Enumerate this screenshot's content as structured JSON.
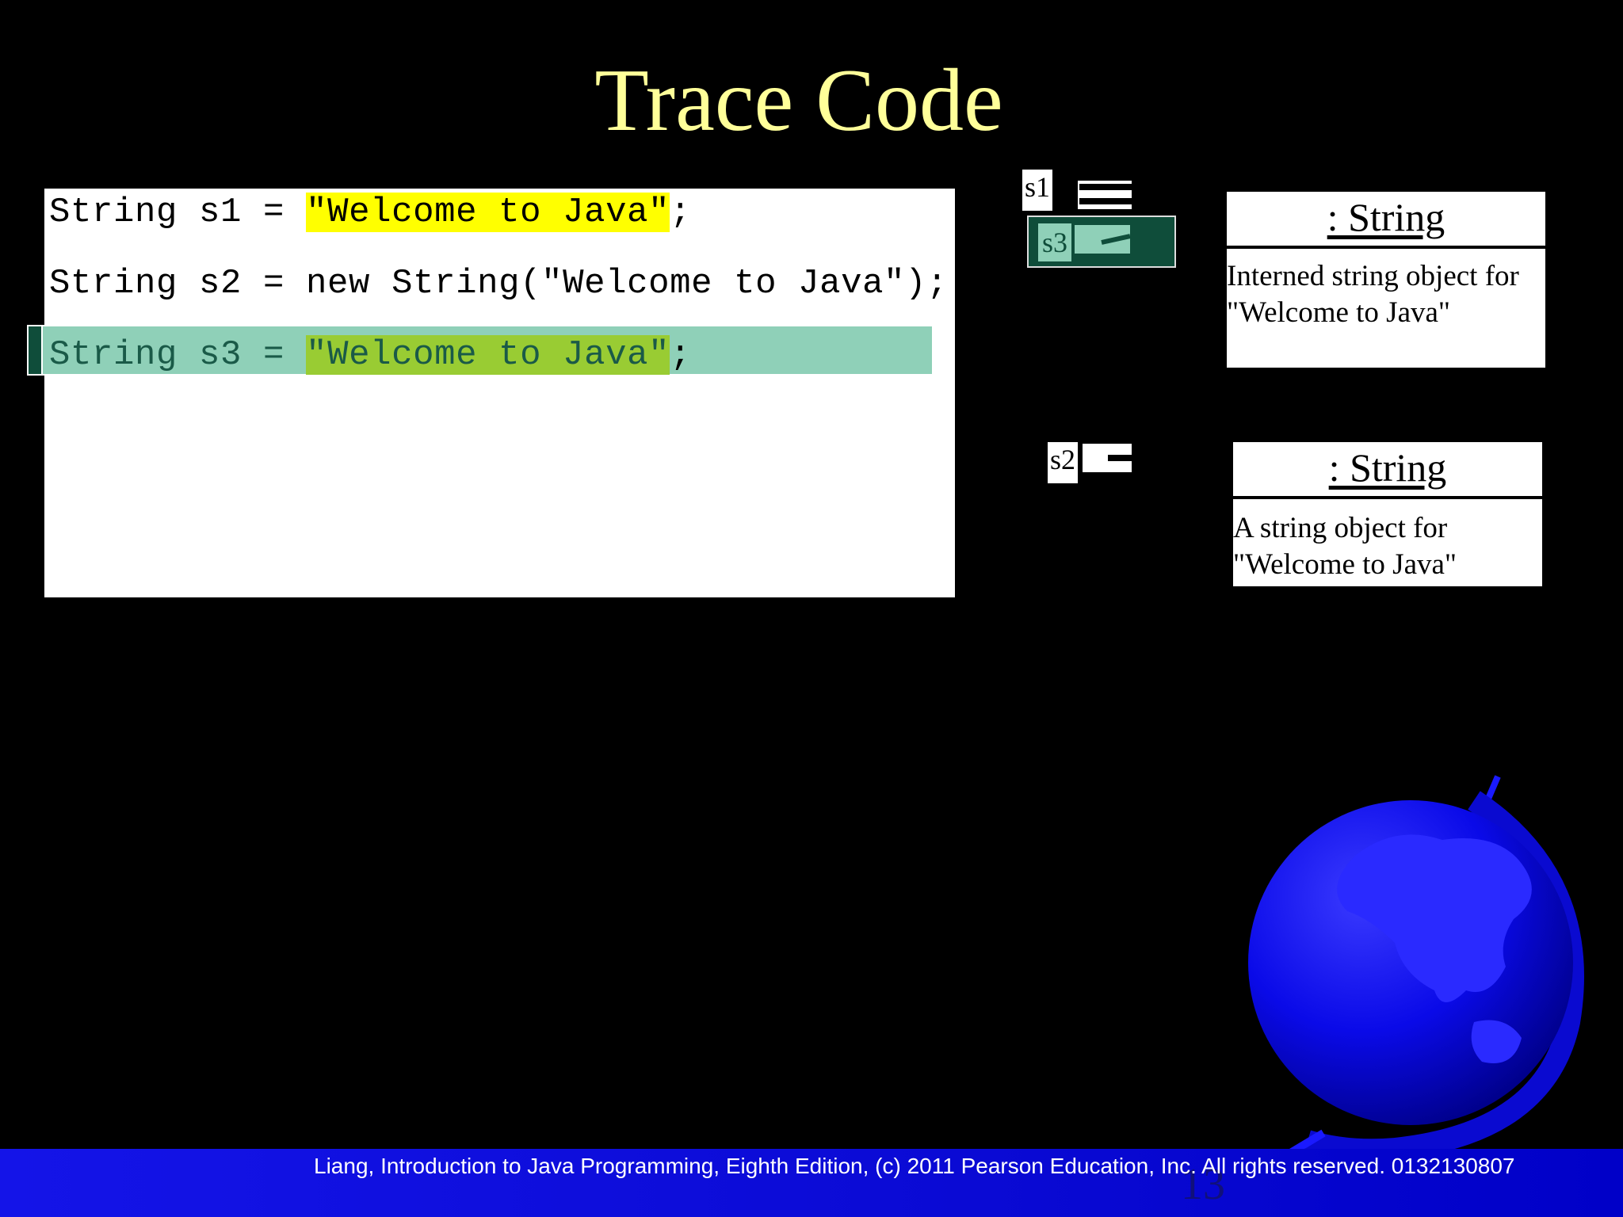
{
  "slide": {
    "title": "Trace Code",
    "page_number": "13",
    "footer": "Liang, Introduction to Java Programming, Eighth Edition, (c) 2011 Pearson Education, Inc. All rights reserved. 0132130807"
  },
  "code": {
    "line1": {
      "prefix": "String s1 = ",
      "literal": "\"Welcome to Java\"",
      "suffix": ";"
    },
    "line2": {
      "text": "String s2 = new String(\"Welcome to Java\");"
    },
    "line3": {
      "prefix": "String s3 = ",
      "literal": "\"Welcome to Java\"",
      "suffix": ";"
    },
    "current_line": 3
  },
  "memory": {
    "variables": {
      "s1": "s1",
      "s2": "s2",
      "s3": "s3"
    },
    "objects": {
      "interned": {
        "header": ": String",
        "description": "Interned string object for\n\"Welcome to Java\""
      },
      "new_string": {
        "header": ": String",
        "description": "A string object for\n\"Welcome to Java\""
      }
    }
  },
  "colors": {
    "background": "#000000",
    "title": "#ffff99",
    "literal_highlight": "#ffff00",
    "current_line_highlight": "#8fd0b8",
    "current_line_marker": "#0f4d3a",
    "footer_bar": "#0a0ad4",
    "globe": "#0000ff"
  },
  "icons": {
    "globe": "globe-icon"
  }
}
